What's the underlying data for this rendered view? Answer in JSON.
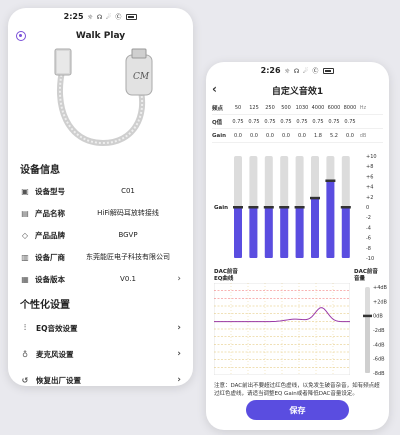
{
  "left": {
    "status": {
      "time": "2:25",
      "icons": "☼ ☊ ☄ Ⓒ",
      "right_icons": "⌂ ▲"
    },
    "title": "Walk Play",
    "section_info": "设备信息",
    "info_rows": [
      {
        "label": "设备型号",
        "value": "C01",
        "icon": "device-icon"
      },
      {
        "label": "产品名称",
        "value": "HiFi解码耳放转接线",
        "icon": "document-icon"
      },
      {
        "label": "产品品牌",
        "value": "BGVP",
        "icon": "tag-icon"
      },
      {
        "label": "设备厂商",
        "value": "东莞能匠电子科技有限公司",
        "icon": "building-icon"
      },
      {
        "label": "设备版本",
        "value": "V0.1",
        "icon": "version-icon"
      }
    ],
    "section_personal": "个性化设置",
    "settings": [
      {
        "label": "EQ音效设置",
        "icon": "equalizer-icon"
      },
      {
        "label": "麦克风设置",
        "icon": "microphone-icon"
      },
      {
        "label": "恢复出厂设置",
        "icon": "reset-icon"
      }
    ],
    "chev": "›"
  },
  "right": {
    "status": {
      "time": "2:26"
    },
    "title": "自定义音效1",
    "back": "‹",
    "row_freq_label": "频点",
    "freqs": [
      "50",
      "125",
      "250",
      "500",
      "1030",
      "4000",
      "6000",
      "8000"
    ],
    "freq_unit": "Hz",
    "row_q_label": "Q值",
    "qvals": [
      "0.75",
      "0.75",
      "0.75",
      "0.75",
      "0.75",
      "0.75",
      "0.75",
      "0.75"
    ],
    "row_gain_label": "Gain",
    "gains": [
      "0.0",
      "0.0",
      "0.0",
      "0.0",
      "0.0",
      "1.8",
      "5.2",
      "0.0"
    ],
    "gain_unit": "dB",
    "gain_side_label": "Gain",
    "gain_scale": [
      "+10",
      "+8",
      "+6",
      "+4",
      "+2",
      "0",
      "-2",
      "-4",
      "-6",
      "-8",
      "-10"
    ],
    "slider_values": [
      0.0,
      0.0,
      0.0,
      0.0,
      0.0,
      1.8,
      5.2,
      0.0
    ],
    "curve_label_1": "DAC前音",
    "curve_label_2": "EQ曲线",
    "dac_label_1": "DAC前音",
    "dac_label_2": "音量",
    "dac_scale": [
      "+4dB",
      "+2dB",
      "0dB",
      "-2dB",
      "-4dB",
      "-6dB",
      "-8dB"
    ],
    "dac_value": 0,
    "note": "注意：DAC前出不要超过红色虚线，以免发生破音杂音，如有频点超过红色虚线，请适当调整EQ Gain或者降低DAC音量设定。",
    "save": "保存",
    "accent": "#5a4de0"
  }
}
